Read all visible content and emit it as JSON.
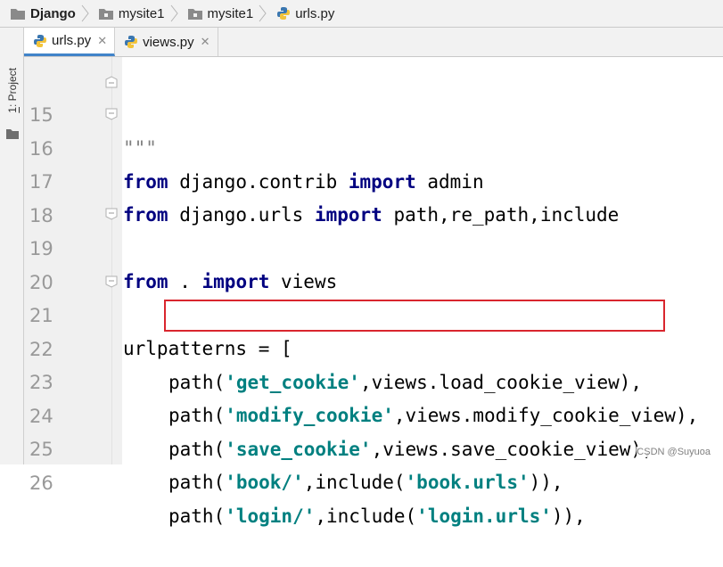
{
  "breadcrumb": [
    {
      "label": "Django",
      "icon": "folder-icon"
    },
    {
      "label": "mysite1",
      "icon": "folder-icon"
    },
    {
      "label": "mysite1",
      "icon": "folder-icon"
    },
    {
      "label": "urls.py",
      "icon": "python-file-icon"
    }
  ],
  "tool_window": {
    "number": "1",
    "label": ": Project"
  },
  "tabs": [
    {
      "label": "urls.py",
      "active": true
    },
    {
      "label": "views.py",
      "active": false
    }
  ],
  "tab_close": "✕",
  "code_lines": [
    {
      "num": "15",
      "text": "\"\"\""
    },
    {
      "num": "16",
      "text": "from django.contrib import admin"
    },
    {
      "num": "17",
      "text": "from django.urls import path,re_path,include"
    },
    {
      "num": "18",
      "text": ""
    },
    {
      "num": "19",
      "text": "from . import views"
    },
    {
      "num": "20",
      "text": ""
    },
    {
      "num": "21",
      "text": "urlpatterns = ["
    },
    {
      "num": "22",
      "text": "path('get_cookie',views.load_cookie_view),"
    },
    {
      "num": "23",
      "text": "path('modify_cookie',views.modify_cookie_view),"
    },
    {
      "num": "24",
      "text": "path('save_cookie',views.save_cookie_view),"
    },
    {
      "num": "25",
      "text": "path('book/',include('book.urls')),"
    },
    {
      "num": "26",
      "text": "path('login/',include('login.urls')),"
    }
  ],
  "watermark": "CSDN @Suyuoa",
  "colors": {
    "keyword": "#000080",
    "string": "#008080",
    "highlight_border": "#d9262e",
    "active_tab_underline": "#4083c9"
  }
}
